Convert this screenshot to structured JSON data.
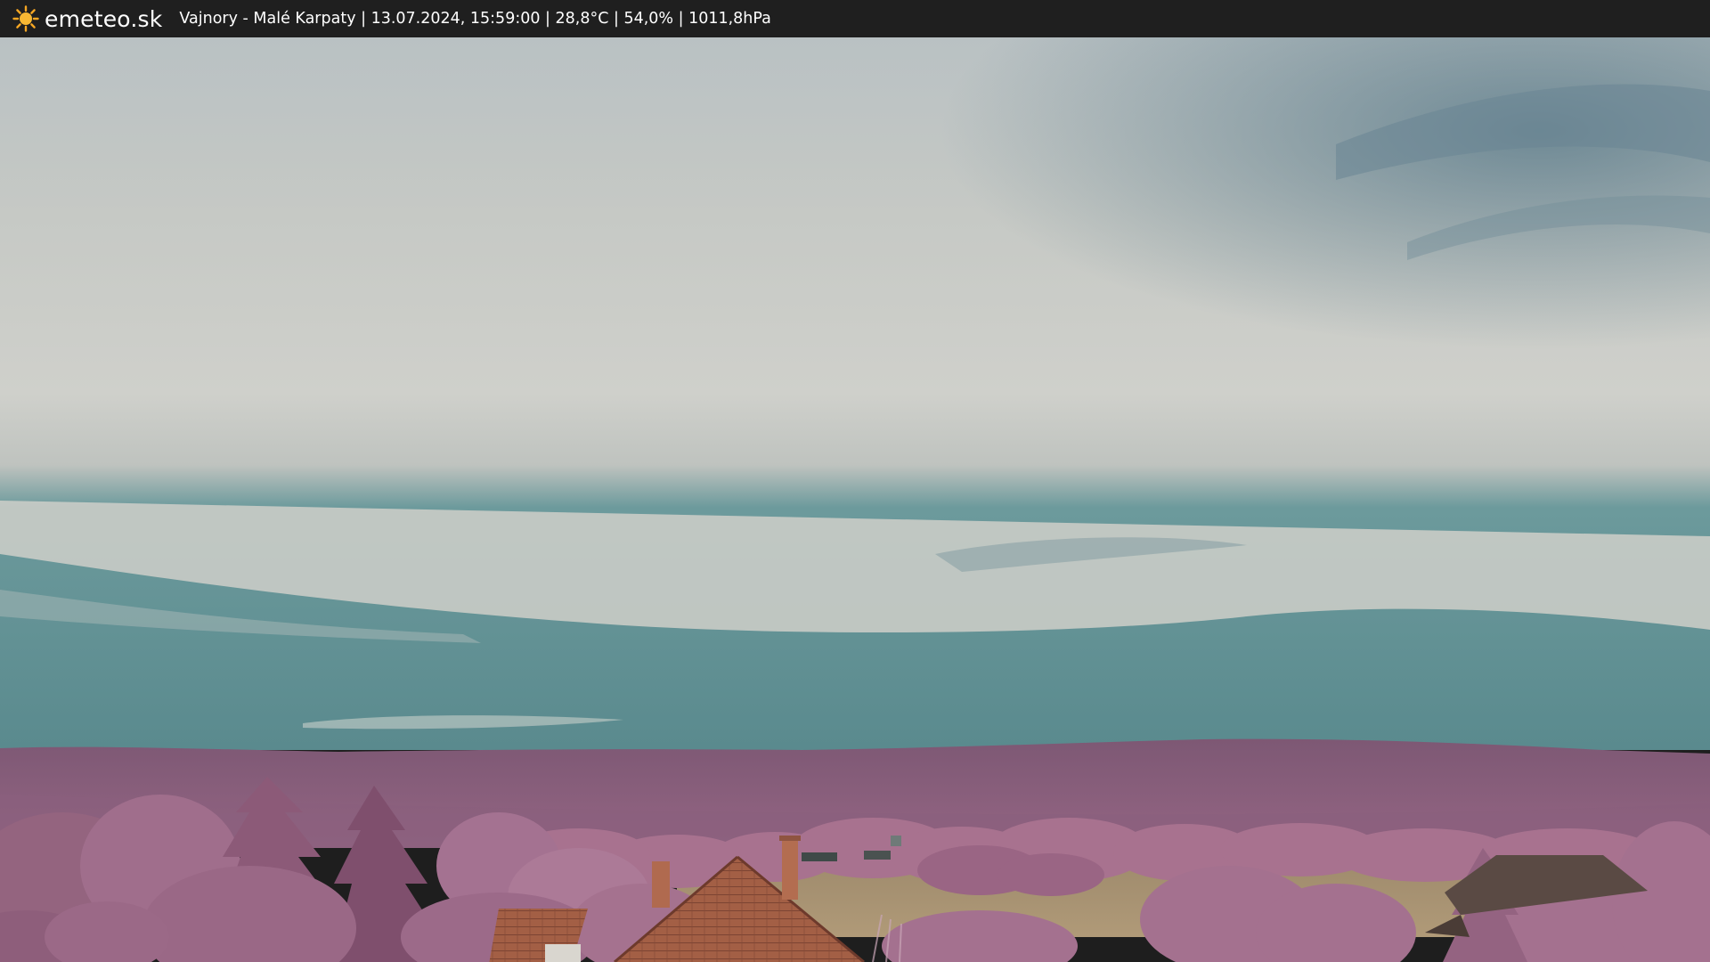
{
  "header": {
    "logo_text": "emeteo.sk",
    "logo_icon": "sun-icon",
    "info": "Vajnory - Malé Karpaty | 13.07.2024, 15:59:00 | 28,8°C | 54,0% | 1011,8hPa"
  },
  "colors": {
    "bar_background": "#1f1f1f",
    "sun": "#f5a623",
    "sky_cloud": "#c9cbc6",
    "sky_clear": "#5f9396",
    "hills": "#8a5d7f",
    "foliage": "#a2708f",
    "roof": "#a8644a",
    "field": "#a8906e"
  }
}
